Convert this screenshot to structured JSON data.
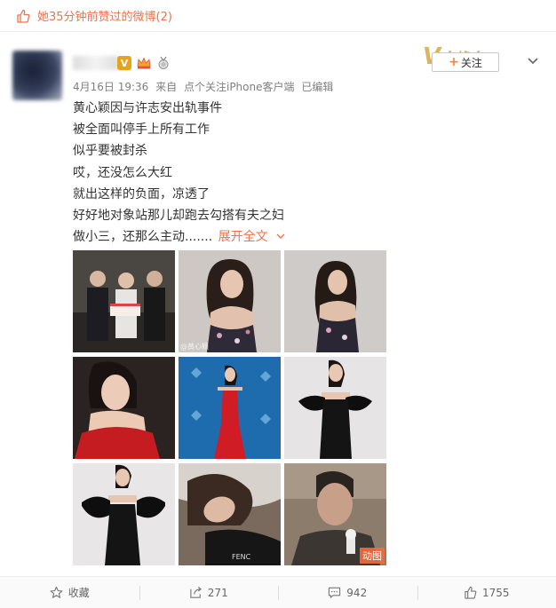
{
  "liked_bar": {
    "text": "她35分钟前赞过的微博(2)"
  },
  "header": {
    "follow_label": "关注",
    "follow_plus": "+",
    "watermark_text": "全峰会",
    "meta": {
      "date": "4月16日 19:36",
      "source_prefix": "来自",
      "source": "点个关注iPhone客户端",
      "edited": "已编辑"
    }
  },
  "post": {
    "lines": [
      "黄心颖因与许志安出轨事件",
      "被全面叫停手上所有工作",
      "似乎要被封杀",
      "哎，还没怎么大红",
      "就出这样的负面，凉透了",
      "好好地对象站那儿却跑去勾搭有夫之妇",
      "做小三，还那么主动......."
    ],
    "expand_label": "展开全文"
  },
  "gallery": {
    "gif_label": "动图",
    "watermark": "@黄心颖",
    "images": [
      {
        "name": "photo-group-cake",
        "bg": "#3b3b3b"
      },
      {
        "name": "photo-floral-dress-1",
        "bg": "#c8c2bd"
      },
      {
        "name": "photo-floral-dress-2",
        "bg": "#c9c5c2"
      },
      {
        "name": "photo-red-dress-closeup",
        "bg": "#201818"
      },
      {
        "name": "photo-red-dress-carpet",
        "bg": "#1f6fb0"
      },
      {
        "name": "photo-black-dress-1",
        "bg": "#e4e2e2"
      },
      {
        "name": "photo-black-dress-2",
        "bg": "#e8e6e6"
      },
      {
        "name": "photo-sleeping",
        "bg": "#5a4a40"
      },
      {
        "name": "photo-man-interview",
        "bg": "#8a7a6a"
      }
    ]
  },
  "footer": {
    "favorite_label": "收藏",
    "repost_count": "271",
    "comment_count": "942",
    "like_count": "1755"
  },
  "colors": {
    "accent": "#eb7350",
    "vip": "#e8a31d"
  }
}
